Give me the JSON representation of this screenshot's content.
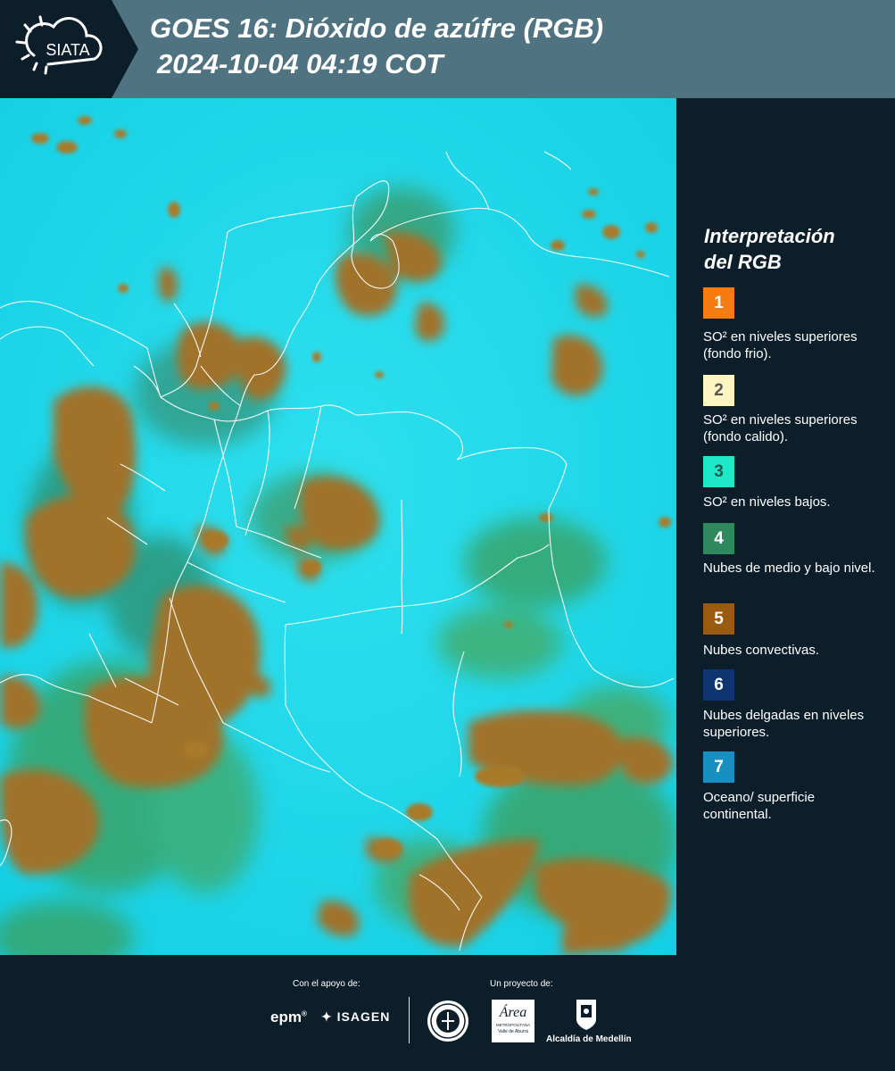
{
  "header": {
    "logo_text": "SIATA",
    "title_line1": "GOES 16: Dióxido de azúfre (RGB)",
    "title_line2": "2024-10-04 04:19 COT"
  },
  "legend": {
    "title_line1": "Interpretación",
    "title_line2": "del RGB",
    "items": [
      {
        "number": "1",
        "label": "SO² en niveles superiores (fondo frio).",
        "color": "#f47c10",
        "number_color": "#ffffff"
      },
      {
        "number": "2",
        "label": "SO² en niveles superiores (fondo calido).",
        "color": "#fff5c2",
        "number_color": "#555555"
      },
      {
        "number": "3",
        "label": "SO² en niveles bajos.",
        "color": "#1ee8c8",
        "number_color": "#1a5a55"
      },
      {
        "number": "4",
        "label": "Nubes de medio y bajo nivel.",
        "color": "#2e8a5e",
        "number_color": "#ffffff"
      },
      {
        "number": "5",
        "label": "Nubes convectivas.",
        "color": "#9a5a12",
        "number_color": "#ffffff"
      },
      {
        "number": "6",
        "label": "Nubes delgadas en niveles superiores.",
        "color": "#0f3570",
        "number_color": "#ffffff"
      },
      {
        "number": "7",
        "label": "Oceano/ superficie continental.",
        "color": "#178fc0",
        "number_color": "#ffffff"
      }
    ]
  },
  "footer": {
    "support_label": "Con el apoyo de:",
    "project_label": "Un proyecto de:",
    "sponsor1": "epm",
    "sponsor2": "ISAGEN",
    "partner1_line1": "Área",
    "partner1_line2": "METROPOLITANA",
    "partner1_line3": "Valle de Aburrá",
    "partner2": "Alcaldía de Medellín"
  },
  "colors": {
    "header_bg": "#4f7380",
    "dark_bg": "#0d1e2b",
    "background_cyan": "#14d2e6",
    "cloud_brown": "#a0722a",
    "cloud_green": "#3d9e52",
    "border_white": "#ffffff"
  }
}
